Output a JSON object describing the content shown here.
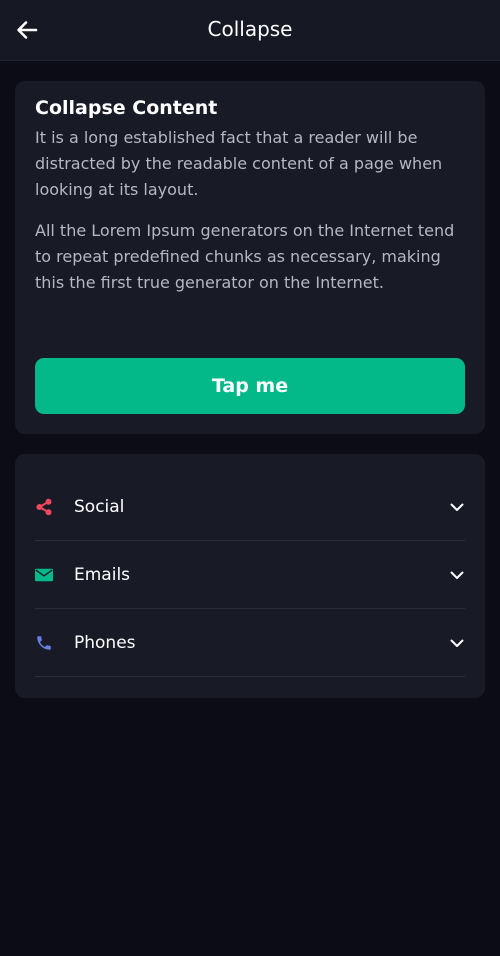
{
  "header": {
    "title": "Collapse",
    "back_icon": "arrow-left-icon"
  },
  "content_card": {
    "title": "Collapse Content",
    "paragraphs": [
      "It is a long established fact that a reader will be distracted by the readable content of a page when looking at its layout.",
      "All the Lorem Ipsum generators on the Internet tend to repeat predefined chunks as necessary, making this the first true generator on the Internet."
    ],
    "button_label": "Tap me"
  },
  "accordion": {
    "items": [
      {
        "label": "Social",
        "icon": "share-icon",
        "icon_color": "#f0475f"
      },
      {
        "label": "Emails",
        "icon": "envelope-icon",
        "icon_color": "#03b98a"
      },
      {
        "label": "Phones",
        "icon": "phone-icon",
        "icon_color": "#6a7fe3"
      }
    ]
  },
  "colors": {
    "background": "#0b0c15",
    "card": "#181a26",
    "accent": "#03b98a",
    "text_secondary": "#b5b7c2"
  }
}
